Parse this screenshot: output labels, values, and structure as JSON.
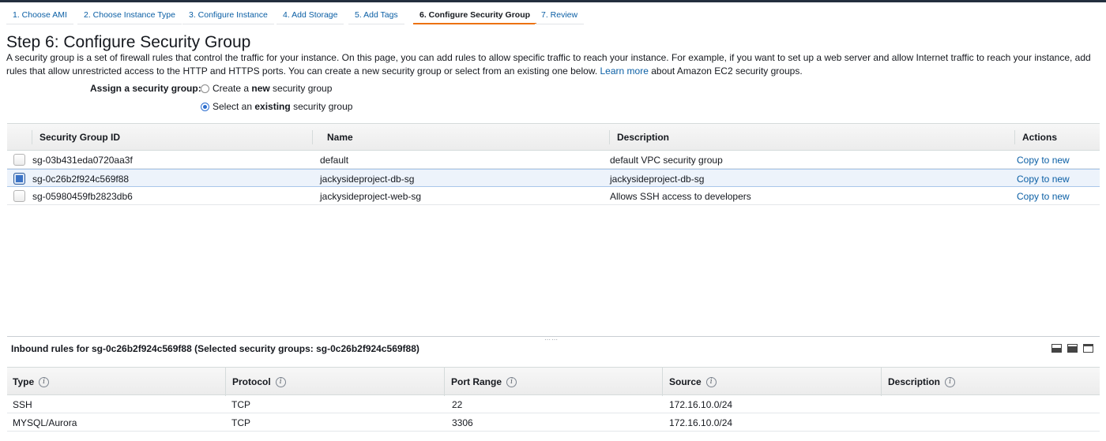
{
  "wizard": {
    "steps": [
      {
        "label": "1. Choose AMI"
      },
      {
        "label": "2. Choose Instance Type"
      },
      {
        "label": "3. Configure Instance"
      },
      {
        "label": "4. Add Storage"
      },
      {
        "label": "5. Add Tags"
      },
      {
        "label": "6. Configure Security Group"
      },
      {
        "label": "7. Review"
      }
    ],
    "active_step": 6
  },
  "page": {
    "title": "Step 6: Configure Security Group",
    "intro_text": "A security group is a set of firewall rules that control the traffic for your instance. On this page, you can add rules to allow specific traffic to reach your instance. For example, if you want to set up a web server and allow Internet traffic to reach your instance, add rules that allow unrestricted access to the HTTP and HTTPS ports. You can create a new security group or select from an existing one below.",
    "learn_more": "Learn more",
    "intro_suffix": "about Amazon EC2 security groups."
  },
  "assign": {
    "label": "Assign a security group:",
    "option_create": {
      "prefix": "Create a ",
      "bold": "new",
      "suffix": " security group"
    },
    "option_existing": {
      "prefix": "Select an ",
      "bold": "existing",
      "suffix": " security group"
    },
    "selected": "existing"
  },
  "security_groups": {
    "columns": [
      "Security Group ID",
      "Name",
      "Description",
      "Actions"
    ],
    "rows": [
      {
        "id": "sg-03b431eda0720aa3f",
        "name": "default",
        "description": "default VPC security group",
        "action": "Copy to new",
        "selected": false
      },
      {
        "id": "sg-0c26b2f924c569f88",
        "name": "jackysideproject-db-sg",
        "description": "jackysideproject-db-sg",
        "action": "Copy to new",
        "selected": true
      },
      {
        "id": "sg-05980459fb2823db6",
        "name": "jackysideproject-web-sg",
        "description": "Allows SSH access to developers",
        "action": "Copy to new",
        "selected": false
      }
    ]
  },
  "inbound": {
    "title": "Inbound rules for sg-0c26b2f924c569f88 (Selected security groups: sg-0c26b2f924c569f88)",
    "columns": [
      "Type",
      "Protocol",
      "Port Range",
      "Source",
      "Description"
    ],
    "rows": [
      {
        "type": "SSH",
        "protocol": "TCP",
        "port_range": "22",
        "source": "172.16.10.0/24",
        "description": ""
      },
      {
        "type": "MYSQL/Aurora",
        "protocol": "TCP",
        "port_range": "3306",
        "source": "172.16.10.0/24",
        "description": ""
      }
    ]
  },
  "icons": {
    "info": "info-icon",
    "view_buttons": [
      "view-split-bottom-icon",
      "view-split-half-icon",
      "view-full-icon"
    ]
  }
}
